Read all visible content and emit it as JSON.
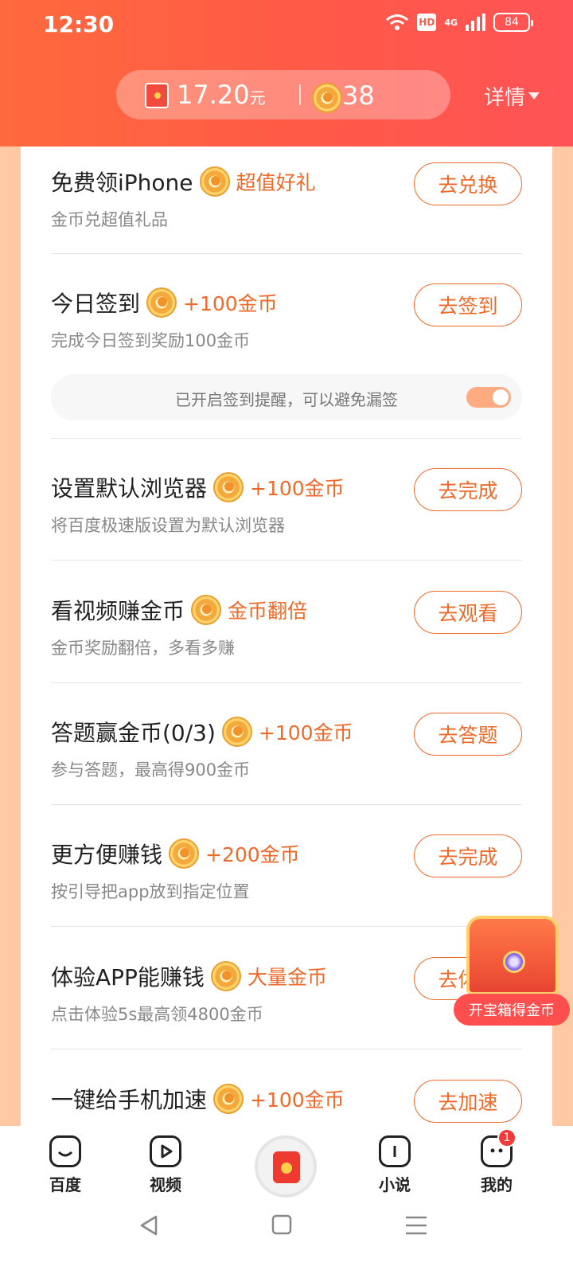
{
  "status_bar": {
    "time": "12:30",
    "hd": "HD",
    "network": "4G",
    "battery": "84"
  },
  "header": {
    "balance_amount": "17.20",
    "balance_unit": "元",
    "coin_count": "38",
    "detail_label": "详情"
  },
  "tasks": [
    {
      "title": "免费领iPhone",
      "reward": "超值好礼",
      "subtitle": "金币兑超值礼品",
      "button": "去兑换"
    },
    {
      "title": "今日签到",
      "reward": "+100金币",
      "subtitle": "完成今日签到奖励100金币",
      "button": "去签到"
    },
    {
      "title": "设置默认浏览器",
      "reward": "+100金币",
      "subtitle": "将百度极速版设置为默认浏览器",
      "button": "去完成"
    },
    {
      "title": "看视频赚金币",
      "reward": "金币翻倍",
      "subtitle": "金币奖励翻倍，多看多赚",
      "button": "去观看"
    },
    {
      "title": "答题赢金币(0/3)",
      "reward": "+100金币",
      "subtitle": "参与答题，最高得900金币",
      "button": "去答题"
    },
    {
      "title": "更方便赚钱",
      "reward": "+200金币",
      "subtitle": "按引导把app放到指定位置",
      "button": "去完成"
    },
    {
      "title": "体验APP能赚钱",
      "reward": "大量金币",
      "subtitle": "点击体验5s最高领4800金币",
      "button": "去体验"
    },
    {
      "title": "一键给手机加速",
      "reward": "+100金币",
      "subtitle": "",
      "button": "去加速"
    }
  ],
  "reminder": {
    "text": "已开启签到提醒，可以避免漏签",
    "enabled": true
  },
  "treasure": {
    "label": "开宝箱得金币"
  },
  "bottom_nav": {
    "items": [
      {
        "label": "百度",
        "icon": "smile-icon"
      },
      {
        "label": "视频",
        "icon": "play-icon"
      },
      {
        "label": "",
        "icon": "red-envelope-icon"
      },
      {
        "label": "小说",
        "icon": "book-icon"
      },
      {
        "label": "我的",
        "icon": "profile-icon"
      }
    ],
    "badge": "1"
  },
  "colors": {
    "accent": "#ee6a2a",
    "header": "#ff5a46"
  }
}
